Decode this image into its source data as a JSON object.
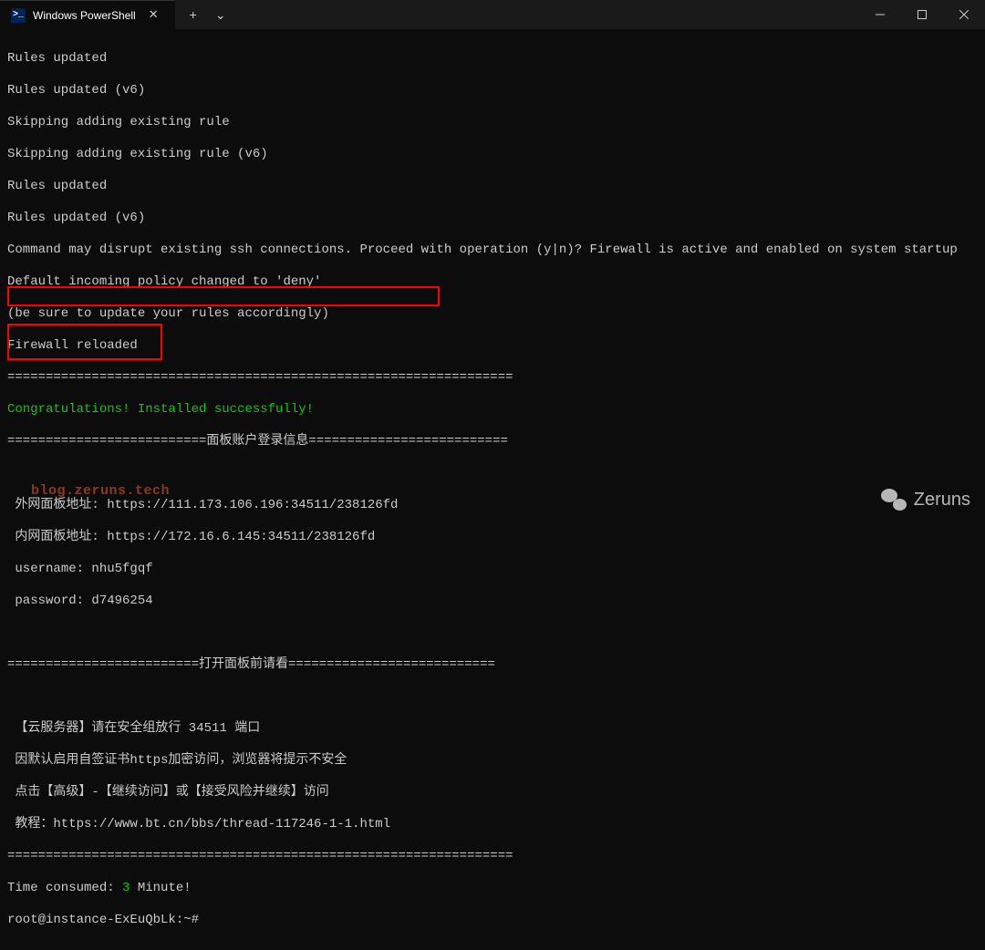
{
  "window": {
    "tab_title": "Windows PowerShell",
    "tab_icon_text": ">_"
  },
  "terminal": {
    "lines": [
      "Rules updated",
      "Rules updated (v6)",
      "Skipping adding existing rule",
      "Skipping adding existing rule (v6)",
      "Rules updated",
      "Rules updated (v6)",
      "Command may disrupt existing ssh connections. Proceed with operation (y|n)? Firewall is active and enabled on system startup",
      "Default incoming policy changed to 'deny'",
      "(be sure to update your rules accordingly)",
      "Firewall reloaded"
    ],
    "sep_top": "==================================================================",
    "congrats": "Congratulations! Installed successfully!",
    "sep_login": "==========================面板账户登录信息==========================",
    "blank": " ",
    "external_url": " 外网面板地址: https://111.173.106.196:34511/238126fd",
    "internal_url": " 内网面板地址: https://172.16.6.145:34511/238126fd",
    "username": " username: nhu5fgqf",
    "password": " password: d7496254",
    "blank2": " ",
    "sep_open": "=========================打开面板前请看===========================",
    "blank3": " ",
    "notice1": " 【云服务器】请在安全组放行 34511 端口",
    "notice2": " 因默认启用自签证书https加密访问，浏览器将提示不安全",
    "notice3": " 点击【高级】-【继续访问】或【接受风险并继续】访问",
    "notice4": " 教程：https://www.bt.cn/bbs/thread-117246-1-1.html",
    "sep_bottom": "==================================================================",
    "time_label": "Time consumed: ",
    "time_value": "3",
    "time_unit": " Minute!",
    "prompt": "root@instance-ExEuQbLk:~#"
  },
  "watermark": {
    "text": "Zeruns",
    "blog": "blog.zeruns.tech"
  }
}
